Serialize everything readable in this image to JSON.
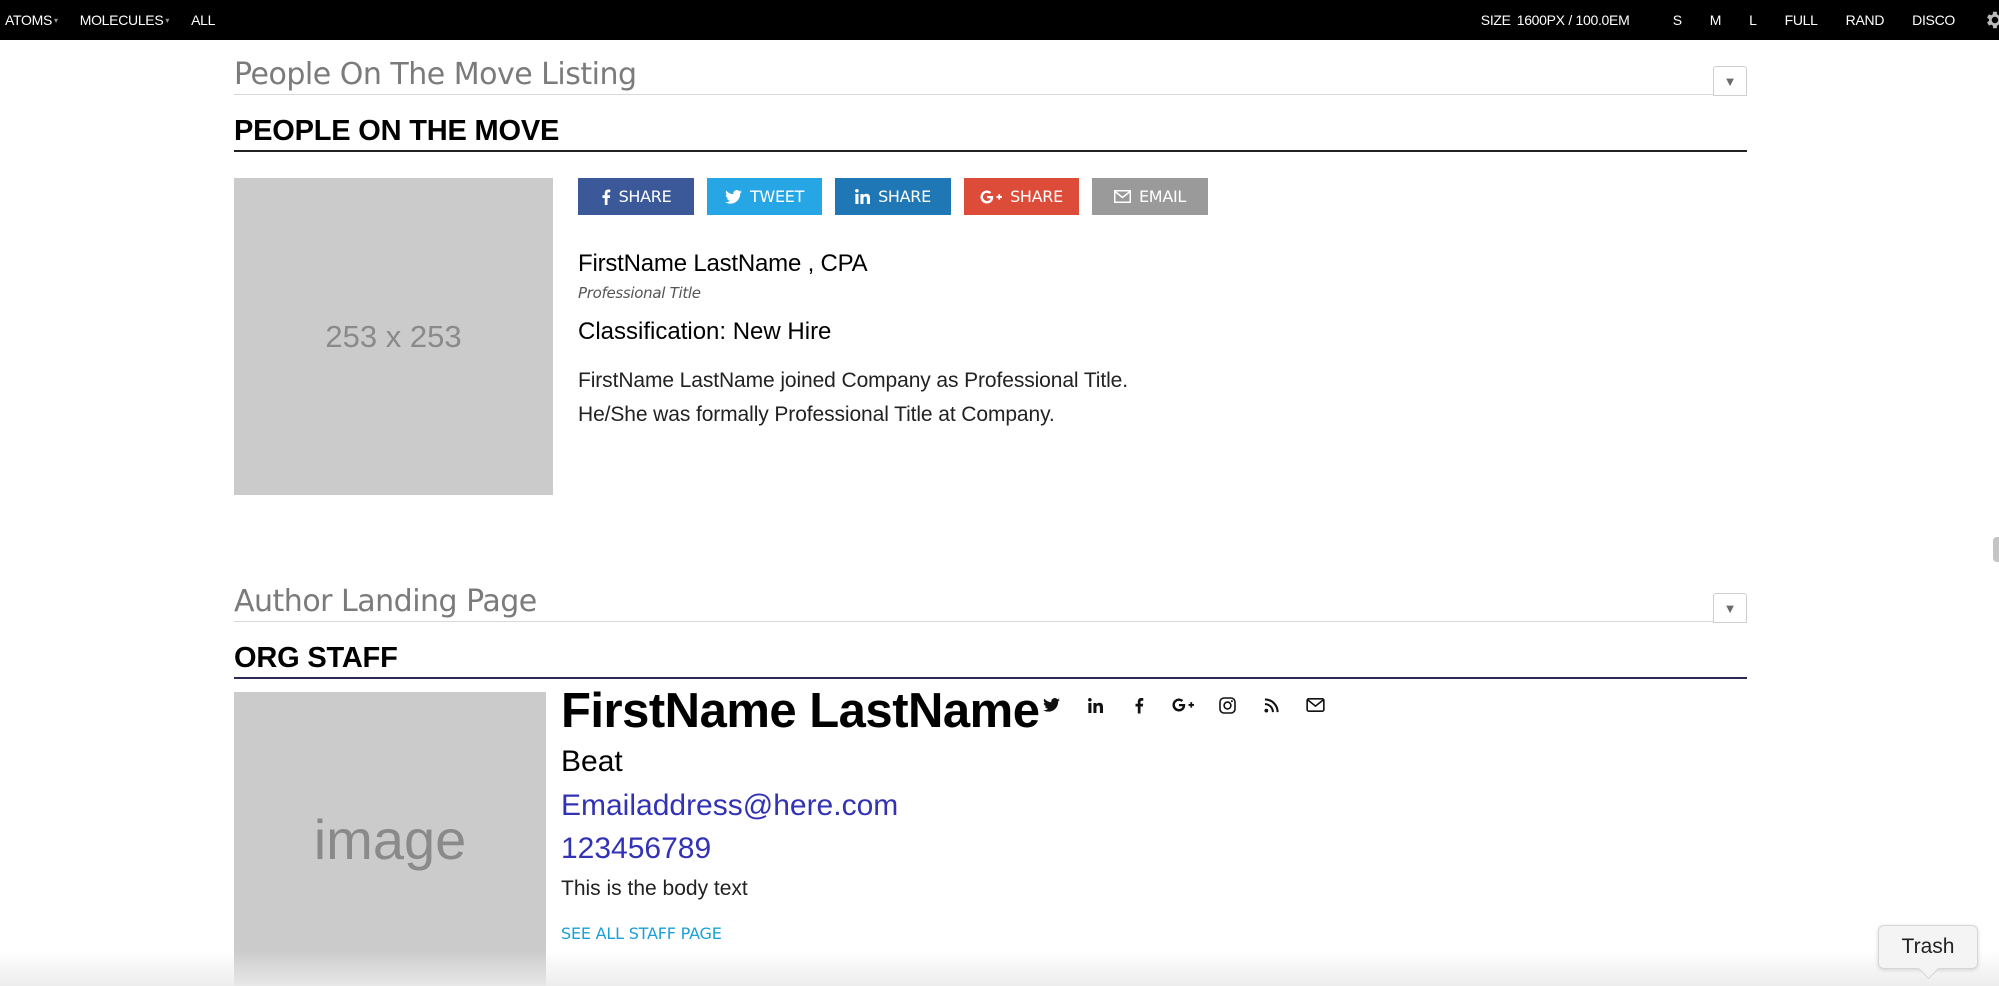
{
  "topbar": {
    "nav": [
      {
        "label": "ATOMS",
        "caret": "▾"
      },
      {
        "label": "MOLECULES",
        "caret": "▾"
      },
      {
        "label": "ALL",
        "caret": ""
      }
    ],
    "size_label": "SIZE",
    "size_value": "1600PX / 100.0EM",
    "controls": [
      "S",
      "M",
      "L",
      "FULL",
      "RAND",
      "DISCO"
    ],
    "gear_icon": "gear-icon"
  },
  "section1": {
    "pattern_title": "People On The Move Listing",
    "toggle": "▼",
    "block_title": "PEOPLE ON THE MOVE",
    "image_label": "253 x 253",
    "share_buttons": [
      {
        "icon": "facebook-icon",
        "label": "SHARE",
        "color": "#3b5998"
      },
      {
        "icon": "twitter-icon",
        "label": "TWEET",
        "color": "#27a6e5"
      },
      {
        "icon": "linkedin-icon",
        "label": "SHARE",
        "color": "#1f77b5"
      },
      {
        "icon": "google-plus-icon",
        "label": "SHARE",
        "color": "#dd4b39"
      },
      {
        "icon": "envelope-icon",
        "label": "EMAIL",
        "color": "#9a9a9a"
      }
    ],
    "name": "FirstName LastName , CPA",
    "professional_title": "Professional Title",
    "classification": "Classification: New Hire",
    "description_line1": "FirstName LastName joined Company as Professional Title.",
    "description_line2": "He/She was formally Professional Title at Company."
  },
  "section2": {
    "pattern_title": "Author Landing Page",
    "toggle": "▼",
    "block_title": "ORG STAFF",
    "image_label": "image",
    "name": "FirstName LastName",
    "social_icons": [
      "twitter-icon",
      "linkedin-icon",
      "facebook-icon",
      "google-plus-icon",
      "instagram-icon",
      "rss-icon",
      "envelope-icon"
    ],
    "beat": "Beat",
    "email": "Emailaddress@here.com",
    "phone": "123456789",
    "body": "This is the body text",
    "link": "SEE ALL STAFF PAGE"
  },
  "trash": {
    "label": "Trash"
  },
  "colors": {
    "link_blue": "#3232b4",
    "staff_link": "#1aa0d6",
    "placeholder": "#cbcbcb"
  }
}
